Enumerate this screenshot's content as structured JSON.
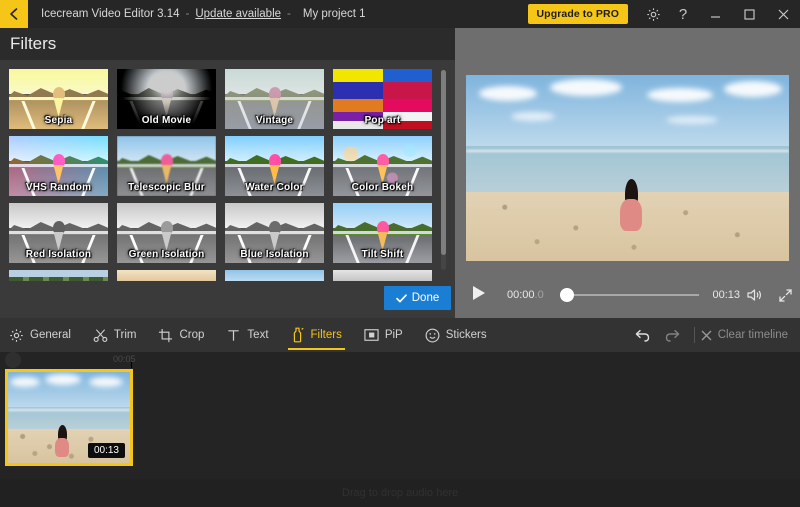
{
  "titlebar": {
    "back_icon": "back-arrow-icon",
    "app_name": "Icecream Video Editor 3.14",
    "separator": "-",
    "update_link": "Update available",
    "project_name": "My project 1",
    "upgrade_label": "Upgrade to PRO",
    "settings_icon": "gear-icon",
    "help_icon": "question-mark-icon",
    "minimize_label": "—",
    "maximize_label": "☐",
    "close_label": "✕"
  },
  "panel": {
    "title": "Filters",
    "done_label": "Done",
    "done_icon": "check-icon",
    "done_color": "#1a7fd4"
  },
  "filters": [
    {
      "name": "Sepia",
      "style": "f-sepia"
    },
    {
      "name": "Old Movie",
      "style": "f-old"
    },
    {
      "name": "Vintage",
      "style": "f-vintage"
    },
    {
      "name": "Pop art",
      "style": "popart"
    },
    {
      "name": "VHS Random",
      "style": "f-vhs"
    },
    {
      "name": "Telescopic Blur",
      "style": "f-blur"
    },
    {
      "name": "Water Color",
      "style": "f-water"
    },
    {
      "name": "Color Bokeh",
      "style": "f-bokeh"
    },
    {
      "name": "Red Isolation",
      "style": "f-gray iso-ball-red"
    },
    {
      "name": "Green Isolation",
      "style": "f-gray iso-ball-green"
    },
    {
      "name": "Blue Isolation",
      "style": "f-gray iso-ball-blue"
    },
    {
      "name": "Tilt Shift",
      "style": "f-tilt"
    }
  ],
  "player": {
    "play_icon": "play-icon",
    "current_time": "00:00",
    "current_fraction": ".0",
    "total_time": "00:13",
    "volume_icon": "volume-on-icon",
    "fullscreen_icon": "fullscreen-icon",
    "progress_percent": 0
  },
  "toolbar": {
    "tabs": [
      {
        "label": "General",
        "icon": "gear-icon",
        "active": false
      },
      {
        "label": "Trim",
        "icon": "scissors-icon",
        "active": false
      },
      {
        "label": "Crop",
        "icon": "crop-icon",
        "active": false
      },
      {
        "label": "Text",
        "icon": "text-icon",
        "active": false
      },
      {
        "label": "Filters",
        "icon": "bottle-icon",
        "active": true
      },
      {
        "label": "PiP",
        "icon": "pip-icon",
        "active": false
      },
      {
        "label": "Stickers",
        "icon": "smiley-icon",
        "active": false
      }
    ],
    "undo_icon": "undo-icon",
    "redo_icon": "redo-icon",
    "clear_timeline_label": "Clear timeline",
    "clear_timeline_icon": "close-x-icon",
    "active_color": "#f5c518"
  },
  "timeline": {
    "ruler_label": "00:05",
    "clip_duration": "00:13",
    "clip_selected_color": "#f5c518",
    "audio_hint": "Drag to drop audio here"
  }
}
